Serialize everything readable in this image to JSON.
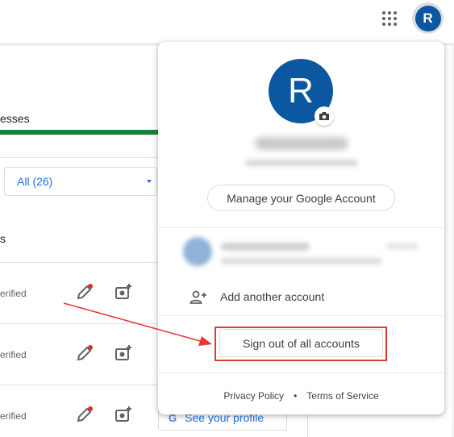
{
  "header": {
    "apps_icon": "apps-grid-icon",
    "avatar_letter": "R"
  },
  "background": {
    "tab_label": "esses",
    "filter": {
      "value": "All (26)"
    },
    "section_label": "s",
    "rows": [
      {
        "status": "erified",
        "cta": ""
      },
      {
        "status": "erified",
        "cta": ""
      },
      {
        "status": "erified",
        "cta": "See your profile"
      }
    ],
    "colors": {
      "tab_accent": "#188038",
      "link": "#1a73e8"
    }
  },
  "popup": {
    "avatar_letter": "R",
    "manage_label": "Manage your Google Account",
    "add_account_label": "Add another account",
    "sign_out_label": "Sign out of all accounts",
    "footer": {
      "privacy": "Privacy Policy",
      "separator": "•",
      "terms": "Terms of Service"
    },
    "colors": {
      "avatar": "#0b57a0"
    }
  },
  "annotation": {
    "color": "#e53935"
  }
}
